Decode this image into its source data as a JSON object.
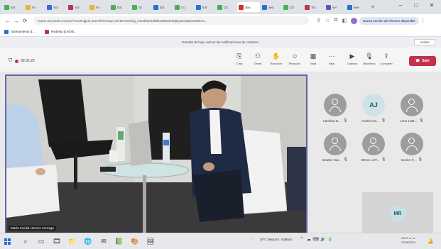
{
  "browser": {
    "tabs": [
      {
        "label": "Ext",
        "color": "#4caf50"
      },
      {
        "label": "Ini",
        "color": "#f0b429"
      },
      {
        "label": "Sol",
        "color": "#2b6fd6"
      },
      {
        "label": "Sol",
        "color": "#c4314b"
      },
      {
        "label": "Ini",
        "color": "#f0b429"
      },
      {
        "label": "Ext",
        "color": "#4caf50"
      },
      {
        "label": "ctt",
        "color": "#4caf50"
      },
      {
        "label": "Ext",
        "color": "#2b6fd6"
      },
      {
        "label": "Co",
        "color": "#4caf50"
      },
      {
        "label": "Ext",
        "color": "#2b6fd6"
      },
      {
        "label": "Ctt",
        "color": "#4caf50"
      },
      {
        "label": "dea",
        "color": "#d93025",
        "active": true
      },
      {
        "label": "aeu",
        "color": "#2b6fd6"
      },
      {
        "label": "Ch",
        "color": "#4caf50"
      },
      {
        "label": "Tar",
        "color": "#c4314b"
      },
      {
        "label": "ser",
        "color": "#6a4fc1"
      },
      {
        "label": "aee",
        "color": "#2b6fd6"
      }
    ],
    "new_tab": "+",
    "window_controls": {
      "minimize": "–",
      "maximize": "□",
      "close": "✕"
    },
    "nav": {
      "back": "←",
      "forward": "→",
      "reload": "⟳"
    },
    "url": "teams.microsoft.com/v2/?meetingjoin=true#/l/meetup-join/19:meeting_OGZlMjAtMDlkLWE5ZGItNjEyZC00Zjc5LWEzN...",
    "restore_label": "Nueva versión de Chrome disponible",
    "menu": "⋮",
    "bookmarks": [
      {
        "label": "Saneamiento d...",
        "color": "#2b6fd6"
      },
      {
        "label": "Redesta DA/DB...",
        "color": "#c4314b"
      }
    ]
  },
  "notification": {
    "text": "Entrada de hoja, activar las notificaciones de contacto.",
    "button": "Activar"
  },
  "meeting": {
    "timer": "02:01:25",
    "tools": [
      {
        "icon": "⎘",
        "label": "Chat"
      },
      {
        "icon": "⚇",
        "label": "Gente"
      },
      {
        "icon": "✋",
        "label": "Reaccion"
      },
      {
        "icon": "☺",
        "label": "Reacción"
      },
      {
        "icon": "▦",
        "label": "Vista"
      },
      {
        "icon": "⋯",
        "label": "Más"
      }
    ],
    "tools2": [
      {
        "icon": "▶",
        "label": "Cámara"
      },
      {
        "icon": "🎙",
        "label": "Micrófono"
      },
      {
        "icon": "⇪",
        "label": "Compartir"
      }
    ],
    "leave_icon": "☎",
    "leave_label": "Salir",
    "active_speaker": "María Cecilia Herrero Arenaga",
    "participants": [
      {
        "initials": "",
        "name": "Carolina G...",
        "mic": "🎙"
      },
      {
        "initials": "AJ",
        "name": "Andrés Hu...",
        "mic": "🎙"
      },
      {
        "initials": "",
        "name": "LOLI LUB...",
        "mic": "🎙"
      },
      {
        "initials": "",
        "name": "Beatriz Gar...",
        "mic": "🎙"
      },
      {
        "initials": "",
        "name": "DECA LGT...",
        "mic": "🎙"
      },
      {
        "initials": "",
        "name": "Doctor F...",
        "mic": "🎙"
      }
    ],
    "self_initials": "MR"
  },
  "taskbar": {
    "search": "⌕",
    "apps": [
      "▭",
      "🎞",
      "📁",
      "🌐",
      "✉",
      "📗",
      "🎨",
      "🖼"
    ],
    "weather": "19°C  Mayorm. nublado",
    "tray_icons": [
      "^",
      "☁",
      "⌨",
      "🔊",
      "🔋"
    ],
    "time": "19:27 a. m.",
    "date": "27/06/2024",
    "notif": "🔔"
  }
}
